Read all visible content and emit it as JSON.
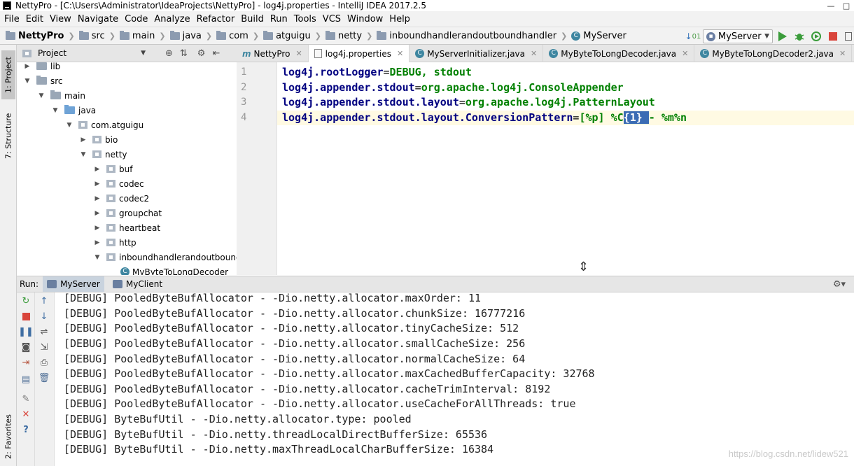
{
  "window": {
    "title": "NettyPro - [C:\\Users\\Administrator\\IdeaProjects\\NettyPro] - log4j.properties - IntelliJ IDEA 2017.2.5"
  },
  "menu": [
    "File",
    "Edit",
    "View",
    "Navigate",
    "Code",
    "Analyze",
    "Refactor",
    "Build",
    "Run",
    "Tools",
    "VCS",
    "Window",
    "Help"
  ],
  "breadcrumbs": [
    "NettyPro",
    "src",
    "main",
    "java",
    "com",
    "atguigu",
    "netty",
    "inboundhandlerandoutboundhandler",
    "MyServer"
  ],
  "run_config": "MyServer",
  "side_tabs": {
    "project": "1: Project",
    "structure": "7: Structure",
    "favorites": "2: Favorites"
  },
  "project_pane": {
    "title": "Project",
    "tree": [
      {
        "label": "lib",
        "depth": 0,
        "kind": "folder",
        "expanded": false
      },
      {
        "label": "src",
        "depth": 0,
        "kind": "folder",
        "expanded": true
      },
      {
        "label": "main",
        "depth": 1,
        "kind": "folder",
        "expanded": true
      },
      {
        "label": "java",
        "depth": 2,
        "kind": "folder-blue",
        "expanded": true
      },
      {
        "label": "com.atguigu",
        "depth": 3,
        "kind": "package",
        "expanded": true
      },
      {
        "label": "bio",
        "depth": 4,
        "kind": "package",
        "expanded": false
      },
      {
        "label": "netty",
        "depth": 4,
        "kind": "package",
        "expanded": true
      },
      {
        "label": "buf",
        "depth": 5,
        "kind": "package",
        "expanded": false
      },
      {
        "label": "codec",
        "depth": 5,
        "kind": "package",
        "expanded": false
      },
      {
        "label": "codec2",
        "depth": 5,
        "kind": "package",
        "expanded": false
      },
      {
        "label": "groupchat",
        "depth": 5,
        "kind": "package",
        "expanded": false
      },
      {
        "label": "heartbeat",
        "depth": 5,
        "kind": "package",
        "expanded": false
      },
      {
        "label": "http",
        "depth": 5,
        "kind": "package",
        "expanded": false
      },
      {
        "label": "inboundhandlerandoutbound",
        "depth": 5,
        "kind": "package",
        "expanded": true
      },
      {
        "label": "MyByteToLongDecoder",
        "depth": 6,
        "kind": "class",
        "expanded": null
      }
    ]
  },
  "editor_tabs": [
    {
      "label": "NettyPro",
      "kind": "module"
    },
    {
      "label": "log4j.properties",
      "kind": "properties",
      "active": true
    },
    {
      "label": "MyServerInitializer.java",
      "kind": "class"
    },
    {
      "label": "MyByteToLongDecoder.java",
      "kind": "class"
    },
    {
      "label": "MyByteToLongDecoder2.java",
      "kind": "class"
    }
  ],
  "editor": {
    "line_numbers": [
      "1",
      "2",
      "3",
      "4"
    ],
    "lines": [
      {
        "key": "log4j.rootLogger",
        "eq": "=",
        "value": "DEBUG, stdout"
      },
      {
        "key": "log4j.appender.stdout",
        "eq": "=",
        "value": "org.apache.log4j.ConsoleAppender"
      },
      {
        "key": "log4j.appender.stdout.layout",
        "eq": "=",
        "value": "org.apache.log4j.PatternLayout"
      },
      {
        "key": "log4j.appender.stdout.layout.ConversionPattern",
        "eq": "=",
        "value_before": "[%p] %C",
        "value_selected": "{1} ",
        "value_after": "- %m%n"
      }
    ]
  },
  "run_window": {
    "label": "Run:",
    "tabs": [
      "MyServer",
      "MyClient"
    ],
    "output": [
      "[DEBUG] PooledByteBufAllocator - -Dio.netty.allocator.maxOrder: 11",
      "[DEBUG] PooledByteBufAllocator - -Dio.netty.allocator.chunkSize: 16777216",
      "[DEBUG] PooledByteBufAllocator - -Dio.netty.allocator.tinyCacheSize: 512",
      "[DEBUG] PooledByteBufAllocator - -Dio.netty.allocator.smallCacheSize: 256",
      "[DEBUG] PooledByteBufAllocator - -Dio.netty.allocator.normalCacheSize: 64",
      "[DEBUG] PooledByteBufAllocator - -Dio.netty.allocator.maxCachedBufferCapacity: 32768",
      "[DEBUG] PooledByteBufAllocator - -Dio.netty.allocator.cacheTrimInterval: 8192",
      "[DEBUG] PooledByteBufAllocator - -Dio.netty.allocator.useCacheForAllThreads: true",
      "[DEBUG] ByteBufUtil - -Dio.netty.allocator.type: pooled",
      "[DEBUG] ByteBufUtil - -Dio.netty.threadLocalDirectBufferSize: 65536",
      "[DEBUG] ByteBufUtil - -Dio.netty.maxThreadLocalCharBufferSize: 16384"
    ]
  },
  "watermark": "https://blog.csdn.net/lidew521",
  "colors": {
    "key": "#000080",
    "value": "#008000",
    "selection": "#3b6cb4",
    "current_line": "#fffae3"
  }
}
